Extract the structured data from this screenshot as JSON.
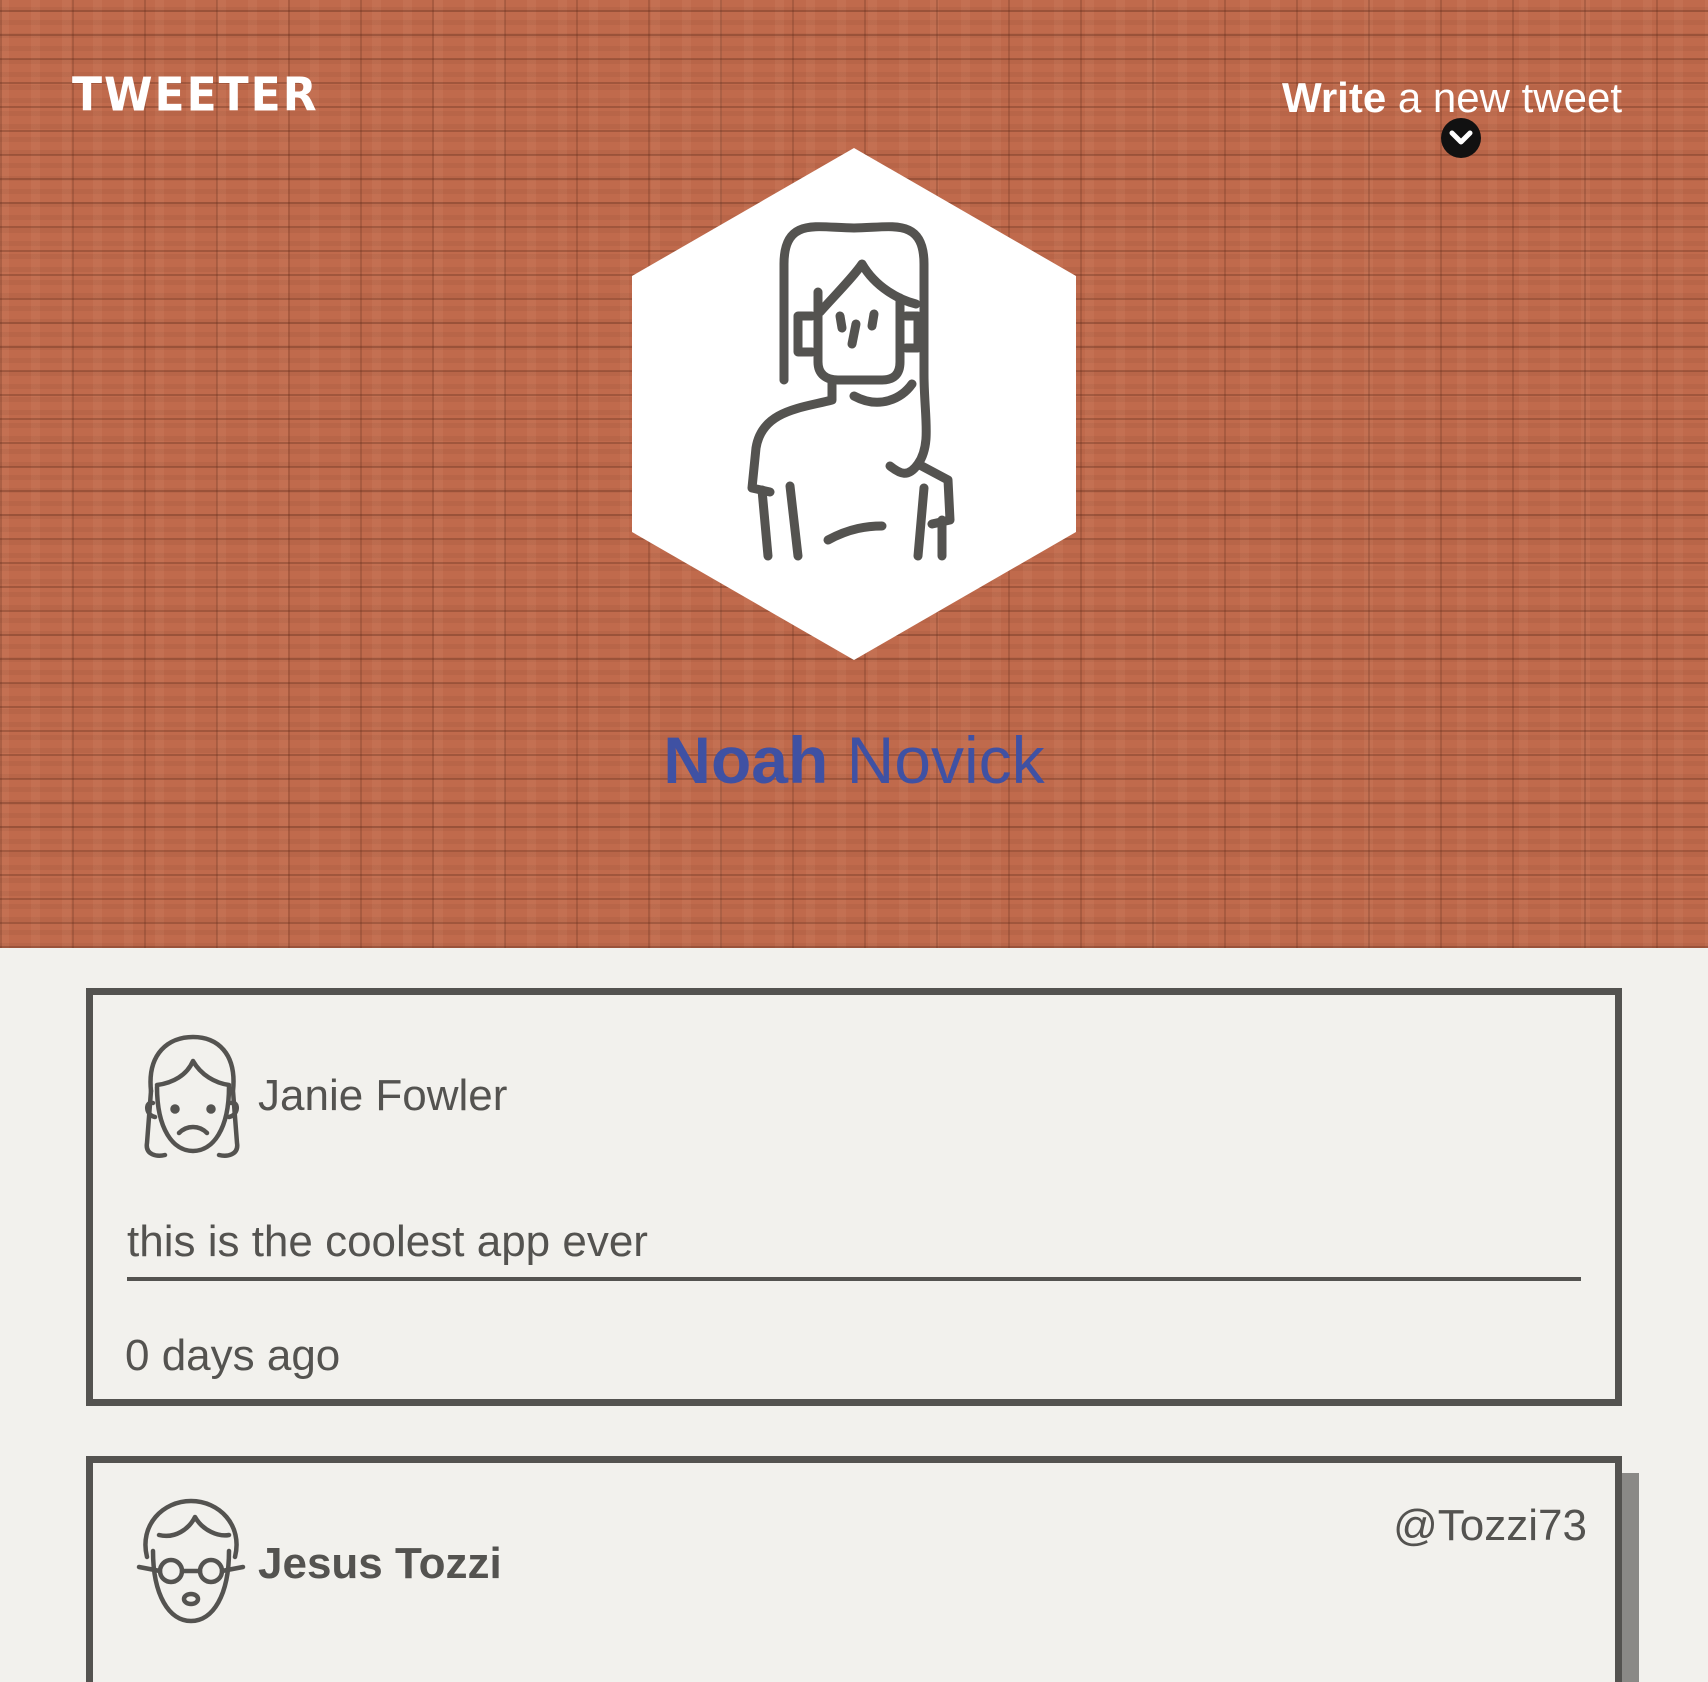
{
  "nav": {
    "brand": "TWEETER",
    "compose_bold": "Write",
    "compose_rest": " a new tweet",
    "compose_icon": "chevron-down-circle-icon"
  },
  "profile": {
    "first_name": "Noah",
    "last_name": "Novick",
    "name_color": "#3f51a3",
    "avatar_icon": "woman-long-hair-avatar"
  },
  "colors": {
    "header_brick": "#c06a4c",
    "page_bg": "#f2f1ed",
    "text": "#545350"
  },
  "tweets": [
    {
      "author": "Janie Fowler",
      "handle": "",
      "avatar_icon": "woman-frowning-avatar",
      "content": "this is the coolest app ever",
      "time": "0 days ago"
    },
    {
      "author": "Jesus Tozzi",
      "handle": "@Tozzi73",
      "avatar_icon": "man-glasses-avatar",
      "content": "",
      "time": ""
    }
  ]
}
